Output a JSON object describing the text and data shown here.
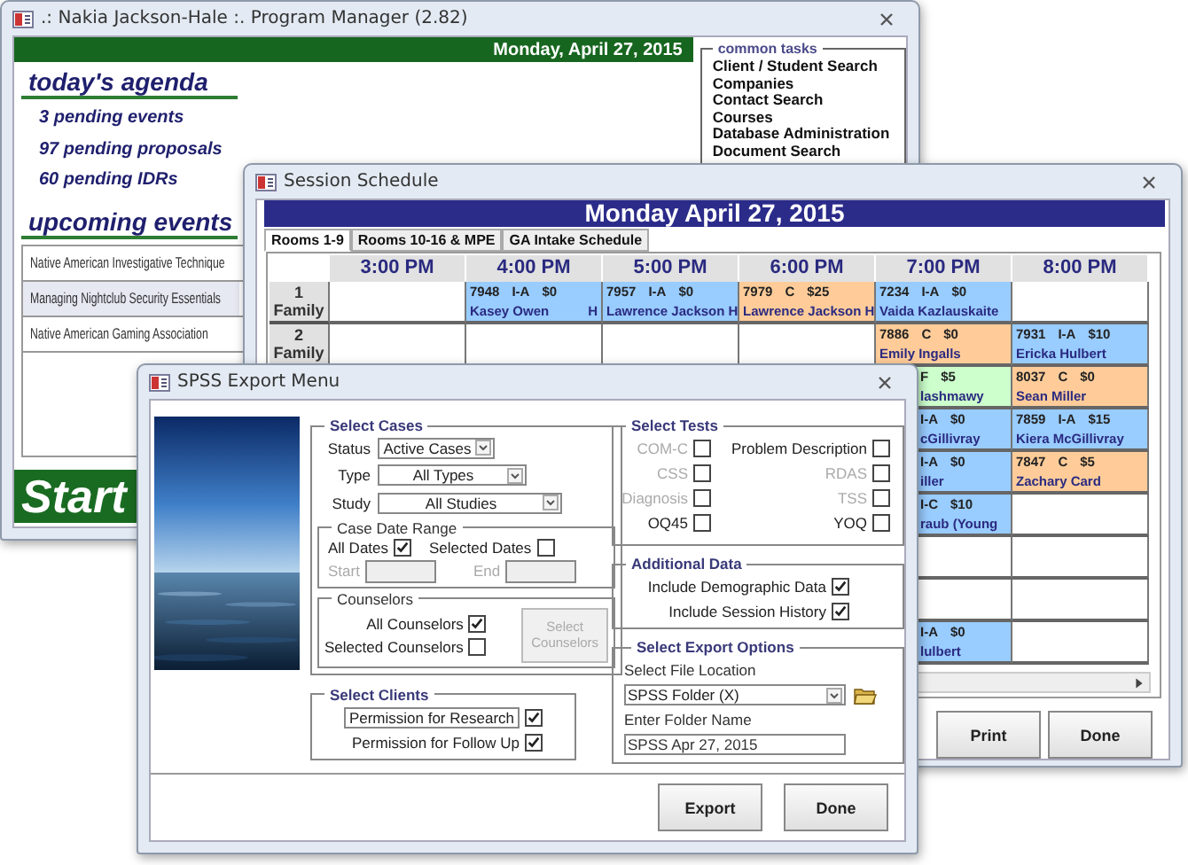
{
  "program_manager": {
    "title": ".: Nakia Jackson-Hale :. Program Manager (2.82)",
    "date": "Monday, April 27, 2015",
    "agenda_heading": "today's agenda",
    "agenda_items": [
      "3 pending events",
      "97 pending proposals",
      "60 pending IDRs"
    ],
    "events_heading": "upcoming events",
    "events": [
      {
        "name": "Native American Investigative Technique",
        "selected": false
      },
      {
        "name": "Managing Nightclub Security Essentials",
        "selected": true
      },
      {
        "name": "Native American Gaming Association",
        "selected": false
      }
    ],
    "start_button": "Start",
    "common_tasks": {
      "title": "common tasks",
      "items": [
        "Client / Student Search",
        "Companies",
        "Contact Search",
        "Courses",
        "Database Administration",
        "Document Search"
      ]
    }
  },
  "session_schedule": {
    "title": "Session Schedule",
    "banner": "Monday April 27, 2015",
    "tabs": [
      {
        "label": "Rooms 1-9",
        "selected": true
      },
      {
        "label": "Rooms 10-16 & MPE",
        "selected": false
      },
      {
        "label": "GA Intake Schedule",
        "selected": false
      }
    ],
    "time_columns": [
      "3:00 PM",
      "4:00 PM",
      "5:00 PM",
      "6:00 PM",
      "7:00 PM",
      "8:00 PM"
    ],
    "rows": [
      {
        "number": "1",
        "name": "Family",
        "cells": [
          null,
          {
            "kind": "full",
            "code": "7948",
            "type": "I-A",
            "fee": "$0",
            "client": "Kasey Owen",
            "flag": "H",
            "color": "#99ccff"
          },
          {
            "kind": "full",
            "code": "7957",
            "type": "I-A",
            "fee": "$0",
            "client": "Lawrence Jackson",
            "flag": "H",
            "color": "#99ccff"
          },
          {
            "kind": "full",
            "code": "7979",
            "type": "C",
            "fee": "$25",
            "client": "Lawrence Jackson",
            "flag": "H",
            "color": "#ffcc99"
          },
          {
            "kind": "full",
            "code": "7234",
            "type": "I-A",
            "fee": "$0",
            "client": "Vaida Kazlauskaite",
            "color": "#99ccff"
          },
          null
        ]
      },
      {
        "number": "2",
        "name": "Family",
        "cells": [
          null,
          null,
          null,
          null,
          {
            "kind": "full",
            "code": "7886",
            "type": "C",
            "fee": "$0",
            "client": "Emily Ingalls",
            "color": "#ffcc99"
          },
          {
            "kind": "full",
            "code": "7931",
            "type": "I-A",
            "fee": "$10",
            "client": "Ericka Hulbert",
            "color": "#99ccff"
          }
        ]
      },
      {
        "cells": [
          null,
          null,
          null,
          null,
          {
            "kind": "partial",
            "type": "F",
            "fee": "$5",
            "client": "lashmawy",
            "color": "#ccffcc"
          },
          {
            "kind": "full",
            "code": "8037",
            "type": "C",
            "fee": "$0",
            "client": "Sean Miller",
            "color": "#ffcc99"
          }
        ]
      },
      {
        "cells": [
          null,
          null,
          null,
          null,
          {
            "kind": "partial",
            "type": "I-A",
            "fee": "$0",
            "client": "cGillivray",
            "color": "#99ccff"
          },
          {
            "kind": "full",
            "code": "7859",
            "type": "I-A",
            "fee": "$15",
            "client": "Kiera McGillivray",
            "color": "#99ccff"
          }
        ]
      },
      {
        "cells": [
          null,
          null,
          null,
          null,
          {
            "kind": "partial",
            "type": "I-A",
            "fee": "$0",
            "client": "iller",
            "color": "#99ccff"
          },
          {
            "kind": "full",
            "code": "7847",
            "type": "C",
            "fee": "$5",
            "client": "Zachary Card",
            "color": "#ffcc99"
          }
        ]
      },
      {
        "cells": [
          null,
          null,
          null,
          null,
          {
            "kind": "partial",
            "type": "I-C",
            "fee": "$10",
            "client": "raub (Young",
            "color": "#99ccff"
          },
          null
        ]
      },
      {
        "cells": [
          null,
          null,
          null,
          null,
          null,
          null
        ]
      },
      {
        "cells": [
          null,
          null,
          null,
          null,
          null,
          null
        ]
      },
      {
        "cells": [
          null,
          null,
          null,
          null,
          {
            "kind": "partial",
            "type": "I-A",
            "fee": "$0",
            "client": "lulbert",
            "color": "#99ccff"
          },
          null
        ]
      }
    ],
    "buttons": [
      "Print",
      "Done"
    ]
  },
  "spss_export": {
    "title": "SPSS Export Menu",
    "select_cases": {
      "title": "Select Cases",
      "fields": [
        {
          "label": "Status",
          "value": "Active Cases"
        },
        {
          "label": "Type",
          "value": "All Types"
        },
        {
          "label": "Study",
          "value": "All Studies"
        }
      ],
      "date_range": {
        "title": "Case Date Range",
        "options": [
          {
            "label": "All Dates",
            "checked": true
          },
          {
            "label": "Selected Dates",
            "checked": false
          }
        ],
        "start_label": "Start",
        "end_label": "End"
      },
      "counselors": {
        "title": "Counselors",
        "options": [
          {
            "label": "All Counselors",
            "checked": true
          },
          {
            "label": "Selected Counselors",
            "checked": false
          }
        ],
        "select_button": {
          "label": "Select Counselors",
          "disabled": true
        }
      }
    },
    "select_clients": {
      "title": "Select Clients",
      "options": [
        {
          "label": "Permission for Research",
          "checked": true,
          "focused": true
        },
        {
          "label": "Permission for Follow Up",
          "checked": true,
          "focused": false
        }
      ]
    },
    "select_tests": {
      "title": "Select Tests",
      "tests": [
        {
          "label": "COM-C",
          "checked": false,
          "disabled": true
        },
        {
          "label": "Problem Description",
          "checked": false,
          "disabled": false
        },
        {
          "label": "CSS",
          "checked": false,
          "disabled": true
        },
        {
          "label": "RDAS",
          "checked": false,
          "disabled": true
        },
        {
          "label": "Diagnosis",
          "checked": false,
          "disabled": true
        },
        {
          "label": "TSS",
          "checked": false,
          "disabled": true
        },
        {
          "label": "OQ45",
          "checked": false,
          "disabled": false
        },
        {
          "label": "YOQ",
          "checked": false,
          "disabled": false
        }
      ]
    },
    "additional_data": {
      "title": "Additional Data",
      "options": [
        {
          "label": "Include Demographic Data",
          "checked": true
        },
        {
          "label": "Include Session History",
          "checked": true
        }
      ]
    },
    "export_options": {
      "title": "Select Export Options",
      "location_label": "Select File Location",
      "location": "SPSS Folder (X)",
      "folder_label": "Enter Folder Name",
      "folder_name": "SPSS Apr 27, 2015"
    },
    "buttons": [
      "Export",
      "Done"
    ]
  }
}
